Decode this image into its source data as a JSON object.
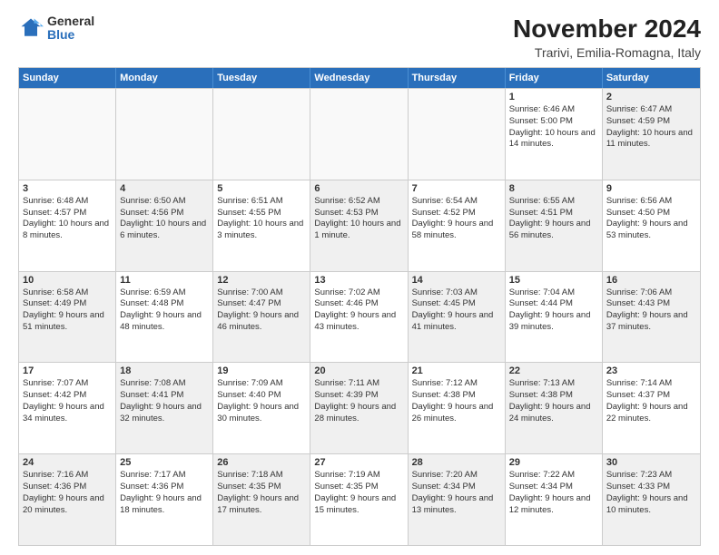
{
  "logo": {
    "general": "General",
    "blue": "Blue"
  },
  "title": "November 2024",
  "subtitle": "Trarivi, Emilia-Romagna, Italy",
  "headers": [
    "Sunday",
    "Monday",
    "Tuesday",
    "Wednesday",
    "Thursday",
    "Friday",
    "Saturday"
  ],
  "rows": [
    [
      {
        "day": "",
        "info": "",
        "empty": true
      },
      {
        "day": "",
        "info": "",
        "empty": true
      },
      {
        "day": "",
        "info": "",
        "empty": true
      },
      {
        "day": "",
        "info": "",
        "empty": true
      },
      {
        "day": "",
        "info": "",
        "empty": true
      },
      {
        "day": "1",
        "info": "Sunrise: 6:46 AM\nSunset: 5:00 PM\nDaylight: 10 hours and 14 minutes.",
        "empty": false
      },
      {
        "day": "2",
        "info": "Sunrise: 6:47 AM\nSunset: 4:59 PM\nDaylight: 10 hours and 11 minutes.",
        "empty": false,
        "shaded": true
      }
    ],
    [
      {
        "day": "3",
        "info": "Sunrise: 6:48 AM\nSunset: 4:57 PM\nDaylight: 10 hours and 8 minutes.",
        "empty": false
      },
      {
        "day": "4",
        "info": "Sunrise: 6:50 AM\nSunset: 4:56 PM\nDaylight: 10 hours and 6 minutes.",
        "empty": false,
        "shaded": true
      },
      {
        "day": "5",
        "info": "Sunrise: 6:51 AM\nSunset: 4:55 PM\nDaylight: 10 hours and 3 minutes.",
        "empty": false
      },
      {
        "day": "6",
        "info": "Sunrise: 6:52 AM\nSunset: 4:53 PM\nDaylight: 10 hours and 1 minute.",
        "empty": false,
        "shaded": true
      },
      {
        "day": "7",
        "info": "Sunrise: 6:54 AM\nSunset: 4:52 PM\nDaylight: 9 hours and 58 minutes.",
        "empty": false
      },
      {
        "day": "8",
        "info": "Sunrise: 6:55 AM\nSunset: 4:51 PM\nDaylight: 9 hours and 56 minutes.",
        "empty": false,
        "shaded": true
      },
      {
        "day": "9",
        "info": "Sunrise: 6:56 AM\nSunset: 4:50 PM\nDaylight: 9 hours and 53 minutes.",
        "empty": false
      }
    ],
    [
      {
        "day": "10",
        "info": "Sunrise: 6:58 AM\nSunset: 4:49 PM\nDaylight: 9 hours and 51 minutes.",
        "empty": false,
        "shaded": true
      },
      {
        "day": "11",
        "info": "Sunrise: 6:59 AM\nSunset: 4:48 PM\nDaylight: 9 hours and 48 minutes.",
        "empty": false
      },
      {
        "day": "12",
        "info": "Sunrise: 7:00 AM\nSunset: 4:47 PM\nDaylight: 9 hours and 46 minutes.",
        "empty": false,
        "shaded": true
      },
      {
        "day": "13",
        "info": "Sunrise: 7:02 AM\nSunset: 4:46 PM\nDaylight: 9 hours and 43 minutes.",
        "empty": false
      },
      {
        "day": "14",
        "info": "Sunrise: 7:03 AM\nSunset: 4:45 PM\nDaylight: 9 hours and 41 minutes.",
        "empty": false,
        "shaded": true
      },
      {
        "day": "15",
        "info": "Sunrise: 7:04 AM\nSunset: 4:44 PM\nDaylight: 9 hours and 39 minutes.",
        "empty": false
      },
      {
        "day": "16",
        "info": "Sunrise: 7:06 AM\nSunset: 4:43 PM\nDaylight: 9 hours and 37 minutes.",
        "empty": false,
        "shaded": true
      }
    ],
    [
      {
        "day": "17",
        "info": "Sunrise: 7:07 AM\nSunset: 4:42 PM\nDaylight: 9 hours and 34 minutes.",
        "empty": false
      },
      {
        "day": "18",
        "info": "Sunrise: 7:08 AM\nSunset: 4:41 PM\nDaylight: 9 hours and 32 minutes.",
        "empty": false,
        "shaded": true
      },
      {
        "day": "19",
        "info": "Sunrise: 7:09 AM\nSunset: 4:40 PM\nDaylight: 9 hours and 30 minutes.",
        "empty": false
      },
      {
        "day": "20",
        "info": "Sunrise: 7:11 AM\nSunset: 4:39 PM\nDaylight: 9 hours and 28 minutes.",
        "empty": false,
        "shaded": true
      },
      {
        "day": "21",
        "info": "Sunrise: 7:12 AM\nSunset: 4:38 PM\nDaylight: 9 hours and 26 minutes.",
        "empty": false
      },
      {
        "day": "22",
        "info": "Sunrise: 7:13 AM\nSunset: 4:38 PM\nDaylight: 9 hours and 24 minutes.",
        "empty": false,
        "shaded": true
      },
      {
        "day": "23",
        "info": "Sunrise: 7:14 AM\nSunset: 4:37 PM\nDaylight: 9 hours and 22 minutes.",
        "empty": false
      }
    ],
    [
      {
        "day": "24",
        "info": "Sunrise: 7:16 AM\nSunset: 4:36 PM\nDaylight: 9 hours and 20 minutes.",
        "empty": false,
        "shaded": true
      },
      {
        "day": "25",
        "info": "Sunrise: 7:17 AM\nSunset: 4:36 PM\nDaylight: 9 hours and 18 minutes.",
        "empty": false
      },
      {
        "day": "26",
        "info": "Sunrise: 7:18 AM\nSunset: 4:35 PM\nDaylight: 9 hours and 17 minutes.",
        "empty": false,
        "shaded": true
      },
      {
        "day": "27",
        "info": "Sunrise: 7:19 AM\nSunset: 4:35 PM\nDaylight: 9 hours and 15 minutes.",
        "empty": false
      },
      {
        "day": "28",
        "info": "Sunrise: 7:20 AM\nSunset: 4:34 PM\nDaylight: 9 hours and 13 minutes.",
        "empty": false,
        "shaded": true
      },
      {
        "day": "29",
        "info": "Sunrise: 7:22 AM\nSunset: 4:34 PM\nDaylight: 9 hours and 12 minutes.",
        "empty": false
      },
      {
        "day": "30",
        "info": "Sunrise: 7:23 AM\nSunset: 4:33 PM\nDaylight: 9 hours and 10 minutes.",
        "empty": false,
        "shaded": true
      }
    ]
  ]
}
